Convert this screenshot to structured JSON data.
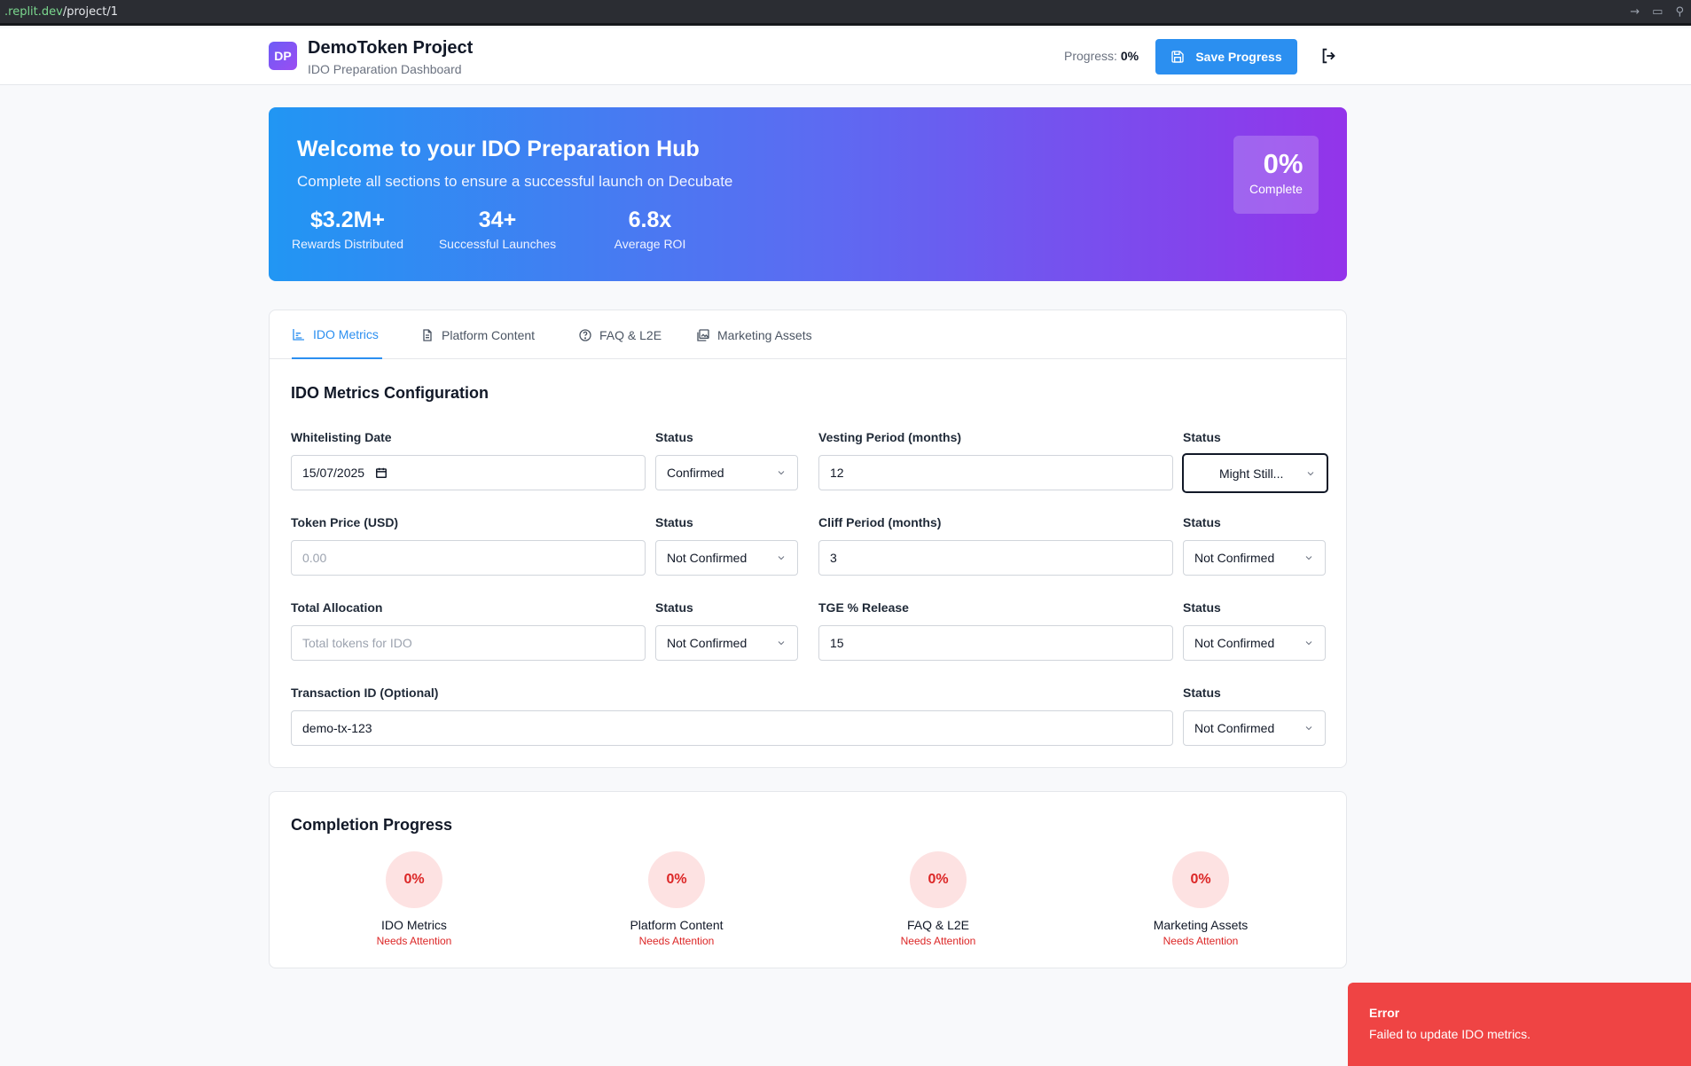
{
  "browser": {
    "url_domain": ".replit.dev",
    "url_path": "/project/1"
  },
  "header": {
    "logo_initials": "DP",
    "project_title": "DemoToken Project",
    "project_subtitle": "IDO Preparation Dashboard",
    "progress_label": "Progress:",
    "progress_value": "0%",
    "save_label": "Save Progress"
  },
  "hero": {
    "title": "Welcome to your IDO Preparation Hub",
    "subtitle": "Complete all sections to ensure a successful launch on Decubate",
    "stats": [
      {
        "value": "$3.2M+",
        "label": "Rewards Distributed"
      },
      {
        "value": "34+",
        "label": "Successful Launches"
      },
      {
        "value": "6.8x",
        "label": "Average ROI"
      }
    ],
    "completion_value": "0%",
    "completion_label": "Complete"
  },
  "tabs": [
    {
      "label": "IDO Metrics",
      "icon": "chart-icon",
      "active": true
    },
    {
      "label": "Platform Content",
      "icon": "document-icon",
      "active": false
    },
    {
      "label": "FAQ & L2E",
      "icon": "help-circle-icon",
      "active": false
    },
    {
      "label": "Marketing Assets",
      "icon": "images-icon",
      "active": false
    }
  ],
  "metrics": {
    "section_title": "IDO Metrics Configuration",
    "status_label": "Status",
    "whitelisting_date": {
      "label": "Whitelisting Date",
      "value": "15/07/2025",
      "status": "Confirmed"
    },
    "token_price": {
      "label": "Token Price (USD)",
      "placeholder": "0.00",
      "status": "Not Confirmed"
    },
    "total_allocation": {
      "label": "Total Allocation",
      "placeholder": "Total tokens for IDO",
      "status": "Not Confirmed"
    },
    "vesting_period": {
      "label": "Vesting Period (months)",
      "value": "12",
      "status": "Might Still..."
    },
    "cliff_period": {
      "label": "Cliff Period (months)",
      "value": "3",
      "status": "Not Confirmed"
    },
    "tge_release": {
      "label": "TGE % Release",
      "value": "15",
      "status": "Not Confirmed"
    },
    "transaction_id": {
      "label": "Transaction ID (Optional)",
      "value": "demo-tx-123",
      "status": "Not Confirmed"
    }
  },
  "completion": {
    "title": "Completion Progress",
    "items": [
      {
        "name": "IDO Metrics",
        "value": "0%",
        "status": "Needs Attention"
      },
      {
        "name": "Platform Content",
        "value": "0%",
        "status": "Needs Attention"
      },
      {
        "name": "FAQ & L2E",
        "value": "0%",
        "status": "Needs Attention"
      },
      {
        "name": "Marketing Assets",
        "value": "0%",
        "status": "Needs Attention"
      }
    ]
  },
  "toast": {
    "title": "Error",
    "message": "Failed to update IDO metrics."
  },
  "colors": {
    "accent": "#2b8ff0",
    "error": "#ef4444",
    "hero_start": "#2196f3",
    "hero_end": "#9334ea"
  }
}
